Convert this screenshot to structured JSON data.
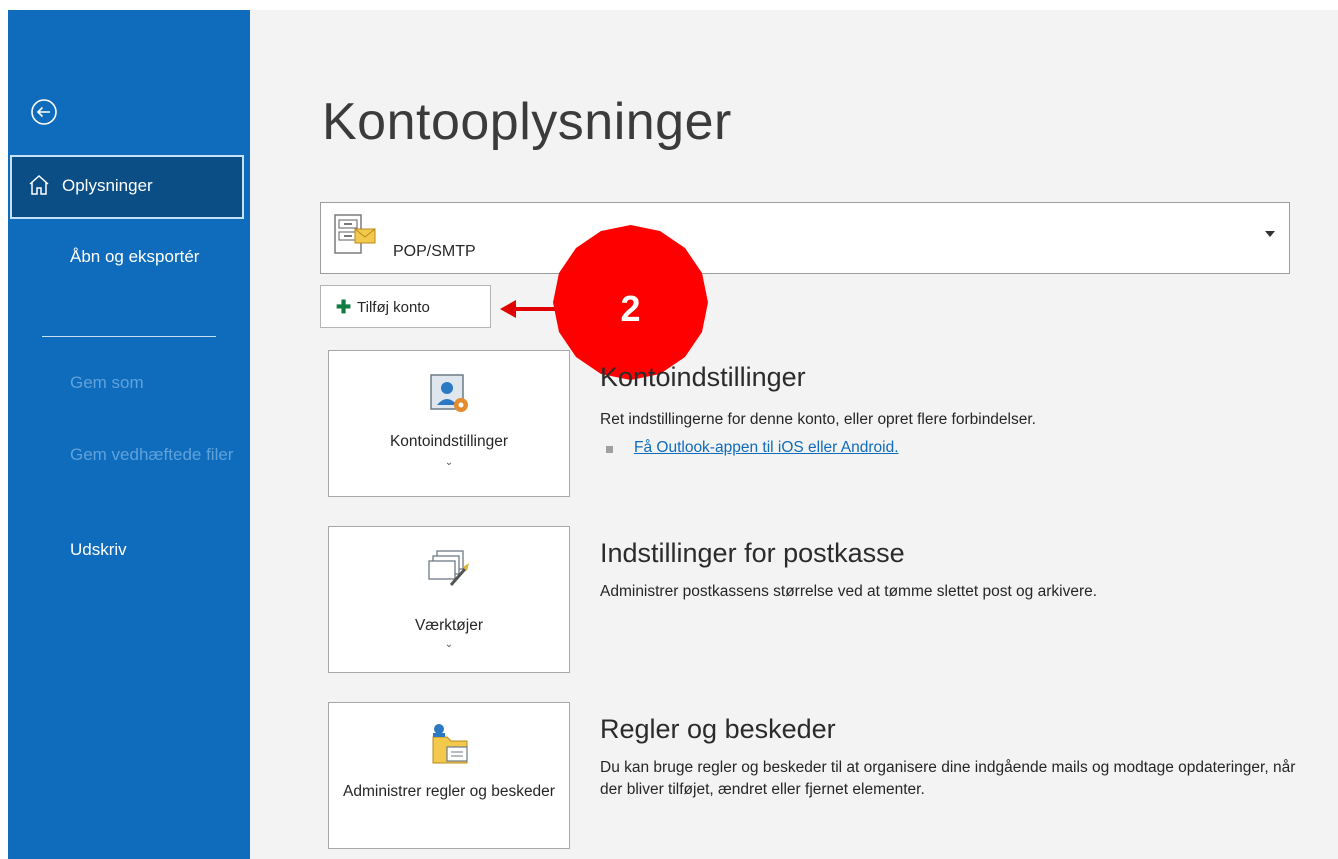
{
  "sidebar": {
    "back_icon": "back-arrow-icon",
    "items": [
      {
        "label": "Oplysninger",
        "icon": "home-icon",
        "active": true
      },
      {
        "label": "Åbn og eksportér"
      },
      {
        "label": "Gem som",
        "disabled": true
      },
      {
        "label": "Gem vedhæftede filer",
        "disabled": true
      },
      {
        "label": "Udskriv"
      }
    ]
  },
  "main": {
    "title": "Kontooplysninger",
    "account": {
      "type": "POP/SMTP",
      "icon": "mailbox-icon"
    },
    "add_account_label": "Tilføj konto",
    "callout_number": "2",
    "sections": [
      {
        "tile_label": "Kontoindstillinger",
        "title": "Kontoindstillinger",
        "description": "Ret indstillingerne for denne konto, eller opret flere forbindelser.",
        "link": "Få Outlook-appen til iOS eller Android."
      },
      {
        "tile_label": "Værktøjer",
        "title": "Indstillinger for postkasse",
        "description": "Administrer postkassens størrelse ved at tømme slettet post og arkivere."
      },
      {
        "tile_label": "Administrer regler og beskeder",
        "title": "Regler og beskeder",
        "description": "Du kan bruge regler og beskeder til at organisere dine indgående mails og modtage opdateringer, når der bliver tilføjet, ændret eller fjernet elementer."
      }
    ]
  },
  "colors": {
    "sidebar": "#0f6cbd",
    "sidebar_active": "#0b4d85",
    "callout": "#ff0000",
    "link": "#0f6cbd"
  }
}
